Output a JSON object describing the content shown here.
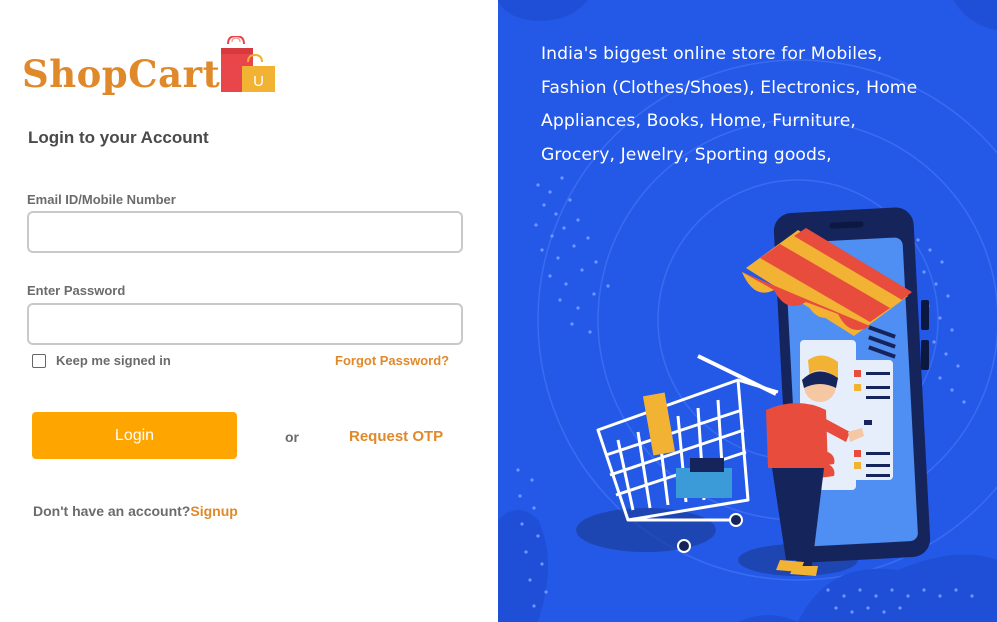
{
  "brand": {
    "name": "ShopCart",
    "bag_letter": "U",
    "color": "#e0892b"
  },
  "login": {
    "heading": "Login to your Account",
    "email_label": "Email ID/Mobile Number",
    "email_value": "",
    "password_label": "Enter Password",
    "password_value": "",
    "keep_signed_in": "Keep me signed in",
    "keep_signed_in_checked": false,
    "forgot_password": "Forgot Password?",
    "login_button": "Login",
    "or_text": "or",
    "request_otp": "Request OTP",
    "no_account": "Don't have an account?",
    "signup": "Signup"
  },
  "promo": {
    "tagline_lines": [
      "India's biggest online store for Mobiles,",
      "Fashion (Clothes/Shoes), Electronics, Home",
      "Appliances, Books, Home, Furniture,",
      "Grocery, Jewelry, Sporting goods,"
    ],
    "illustration": "shopper-with-cart-and-phone-storefront"
  },
  "colors": {
    "accent": "#ffa500",
    "link": "#e0892b",
    "panel_bg": "#2459e8",
    "text_muted": "#6b6b6b"
  }
}
